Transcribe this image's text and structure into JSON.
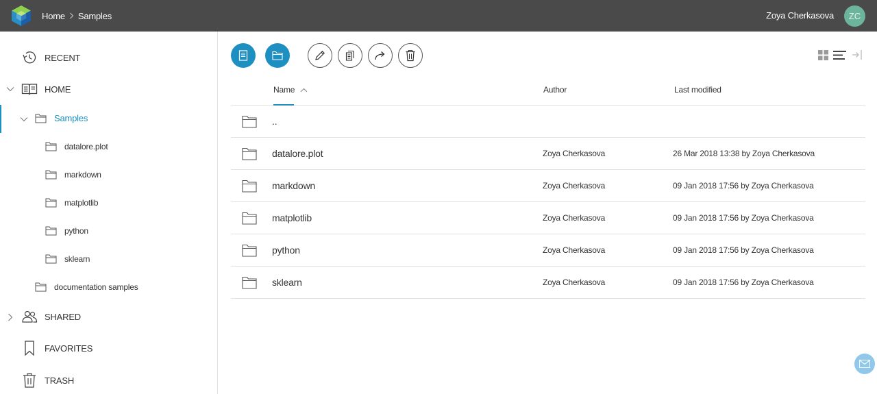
{
  "header": {
    "breadcrumb": [
      "Home",
      "Samples"
    ],
    "user_name": "Zoya Cherkasova",
    "avatar_initials": "ZC",
    "logo_icon": "datalore-cube-logo"
  },
  "sidebar": {
    "recent": "RECENT",
    "home": "HOME",
    "samples": "Samples",
    "sample_children": [
      "datalore.plot",
      "markdown",
      "matplotlib",
      "python",
      "sklearn"
    ],
    "documentation_samples": "documentation samples",
    "shared": "SHARED",
    "favorites": "FAVORITES",
    "trash": "TRASH"
  },
  "toolbar": {
    "icons": [
      "new-notebook-icon",
      "new-folder-icon",
      "rename-icon",
      "duplicate-icon",
      "move-icon",
      "delete-icon"
    ],
    "view_icons": [
      "grid-view-icon",
      "list-view-icon",
      "collapse-panel-icon"
    ]
  },
  "table": {
    "columns": {
      "name": "Name",
      "author": "Author",
      "last_modified": "Last modified"
    },
    "sort": {
      "column": "Name",
      "direction": "ascending"
    },
    "parent_row": "..",
    "rows": [
      {
        "name": "datalore.plot",
        "author": "Zoya Cherkasova",
        "modified": "26 Mar 2018 13:38 by Zoya Cherkasova"
      },
      {
        "name": "markdown",
        "author": "Zoya Cherkasova",
        "modified": "09 Jan 2018 17:56 by Zoya Cherkasova"
      },
      {
        "name": "matplotlib",
        "author": "Zoya Cherkasova",
        "modified": "09 Jan 2018 17:56 by Zoya Cherkasova"
      },
      {
        "name": "python",
        "author": "Zoya Cherkasova",
        "modified": "09 Jan 2018 17:56 by Zoya Cherkasova"
      },
      {
        "name": "sklearn",
        "author": "Zoya Cherkasova",
        "modified": "09 Jan 2018 17:56 by Zoya Cherkasova"
      }
    ]
  },
  "colors": {
    "accent": "#1d8fc0",
    "topbar": "#4a4a4a",
    "avatar": "#6db49d",
    "feedback": "#8fc8ea"
  }
}
